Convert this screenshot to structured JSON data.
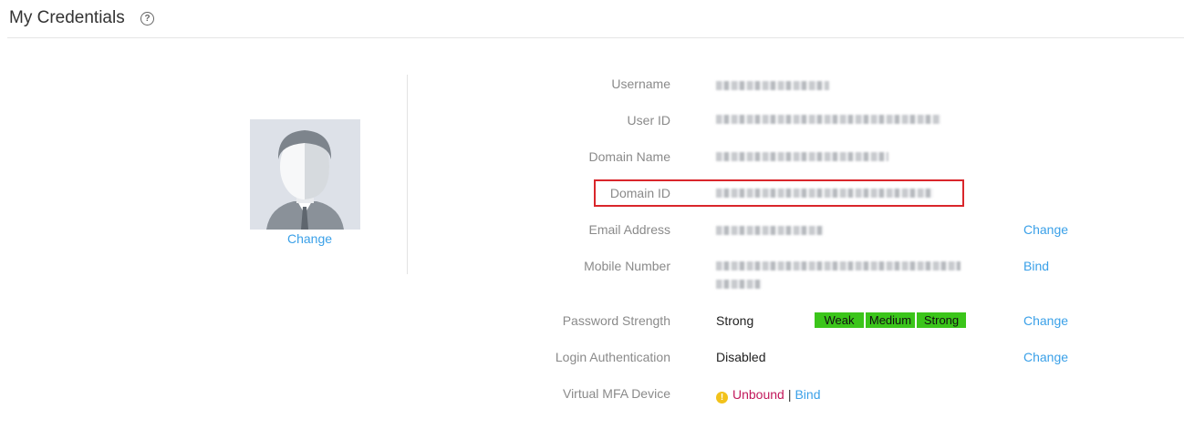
{
  "header": {
    "title": "My Credentials",
    "help_icon": "?"
  },
  "avatar": {
    "change_label": "Change"
  },
  "fields": {
    "username": {
      "label": "Username"
    },
    "user_id": {
      "label": "User ID"
    },
    "domain_name": {
      "label": "Domain Name"
    },
    "domain_id": {
      "label": "Domain ID"
    },
    "email": {
      "label": "Email Address",
      "action": "Change"
    },
    "mobile": {
      "label": "Mobile Number",
      "action": "Bind"
    },
    "password_strength": {
      "label": "Password Strength",
      "value": "Strong",
      "levels": [
        "Weak",
        "Medium",
        "Strong"
      ],
      "action": "Change"
    },
    "login_auth": {
      "label": "Login Authentication",
      "value": "Disabled",
      "action": "Change"
    },
    "mfa": {
      "label": "Virtual MFA Device",
      "status": "Unbound",
      "separator": "|",
      "action": "Bind"
    }
  },
  "colors": {
    "link": "#3aa0e8",
    "strength_bar": "#3bc51a",
    "unbound": "#c2185b",
    "highlight": "#d9262b"
  }
}
